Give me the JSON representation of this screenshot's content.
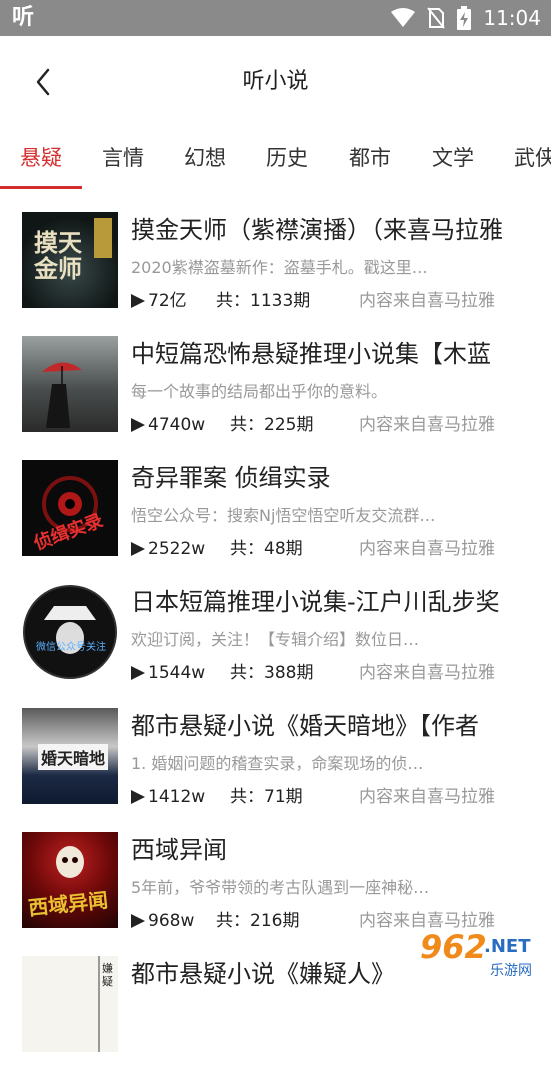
{
  "status_bar": {
    "app_glyph": "听",
    "time": "11:04",
    "icons": [
      "wifi-icon",
      "no-sim-icon",
      "battery-charging-icon"
    ]
  },
  "header": {
    "back_icon": "chevron-left-icon",
    "title": "听小说"
  },
  "tabs": [
    {
      "label": "悬疑",
      "active": true
    },
    {
      "label": "言情",
      "active": false
    },
    {
      "label": "幻想",
      "active": false
    },
    {
      "label": "历史",
      "active": false
    },
    {
      "label": "都市",
      "active": false
    },
    {
      "label": "文学",
      "active": false
    },
    {
      "label": "武侠",
      "active": false
    }
  ],
  "items": [
    {
      "title": "摸金天师（紫襟演播）（来喜马拉雅",
      "description": "2020紫襟盗墓新作：盗墓手札。戳这里…",
      "plays": "72亿",
      "episodes": "共：1133期",
      "source": "内容来自喜马拉雅",
      "cover_text": "摸天金师"
    },
    {
      "title": "中短篇恐怖悬疑推理小说集【木蓝",
      "description": "每一个故事的结局都出乎你的意料。",
      "plays": "4740w",
      "episodes": "共：225期",
      "source": "内容来自喜马拉雅",
      "cover_text": ""
    },
    {
      "title": "奇异罪案 侦缉实录",
      "description": "悟空公众号：搜索Nj悟空悟空听友交流群…",
      "plays": "2522w",
      "episodes": "共：48期",
      "source": "内容来自喜马拉雅",
      "cover_text": "侦缉实录"
    },
    {
      "title": "日本短篇推理小说集-江户川乱步奖",
      "description": "欢迎订阅，关注！【专辑介绍】数位日…",
      "plays": "1544w",
      "episodes": "共：388期",
      "source": "内容来自喜马拉雅",
      "cover_text": "微信公众号关注"
    },
    {
      "title": "都市悬疑小说《婚天暗地》【作者",
      "description": "1. 婚姻问题的稽查实录，命案现场的侦…",
      "plays": "1412w",
      "episodes": "共：71期",
      "source": "内容来自喜马拉雅",
      "cover_text": "婚天暗地"
    },
    {
      "title": "西域异闻",
      "description": "5年前，爷爷带领的考古队遇到一座神秘…",
      "plays": "968w",
      "episodes": "共：216期",
      "source": "内容来自喜马拉雅",
      "cover_text": "西域异闻"
    },
    {
      "title": "都市悬疑小说《嫌疑人》",
      "description": "",
      "plays": "",
      "episodes": "",
      "source": "",
      "cover_text": "嫌疑"
    }
  ],
  "watermark": {
    "brand": "962",
    "suffix": ".NET",
    "sub": "乐游网"
  },
  "colors": {
    "accent": "#d32f2f",
    "status_bar": "#8a8a8a",
    "muted": "#999999"
  }
}
